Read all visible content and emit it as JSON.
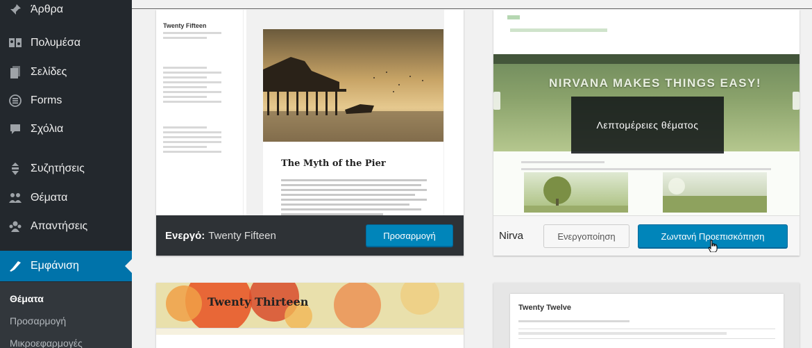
{
  "sidebar": {
    "items": [
      {
        "label": "Άρθρα",
        "icon": "pin-icon"
      },
      {
        "label": "Πολυμέσα",
        "icon": "media-icon"
      },
      {
        "label": "Σελίδες",
        "icon": "pages-icon"
      },
      {
        "label": "Forms",
        "icon": "forms-icon"
      },
      {
        "label": "Σχόλια",
        "icon": "comments-icon"
      },
      {
        "label": "Συζητήσεις",
        "icon": "discussions-icon"
      },
      {
        "label": "Θέματα",
        "icon": "topics-icon"
      },
      {
        "label": "Απαντήσεις",
        "icon": "replies-icon"
      },
      {
        "label": "Εμφάνιση",
        "icon": "appearance-icon"
      }
    ],
    "submenu": [
      "Θέματα",
      "Προσαρμογή",
      "Μικροεφαρμογές"
    ]
  },
  "themes": {
    "active": {
      "prefix": "Ενεργό:",
      "name": "Twenty Fifteen",
      "customize_label": "Προσαρμογή",
      "preview_site_title": "Twenty Fifteen",
      "preview_post_title": "The Myth of the Pier"
    },
    "nirvana": {
      "name": "Nirva",
      "hero_text": "NIRVANA MAKES THINGS EASY!",
      "details_label": "Λεπτομέρειες θέματος",
      "activate_label": "Ενεργοποίηση",
      "live_preview_label": "Ζωντανή Προεπισκόπηση"
    },
    "twenty_thirteen": {
      "preview_title": "Twenty Thirteen"
    },
    "twenty_twelve": {
      "preview_title": "Twenty Twelve"
    }
  },
  "colors": {
    "sidebar_bg": "#23282d",
    "accent": "#0073aa",
    "button_primary": "#0085ba"
  }
}
